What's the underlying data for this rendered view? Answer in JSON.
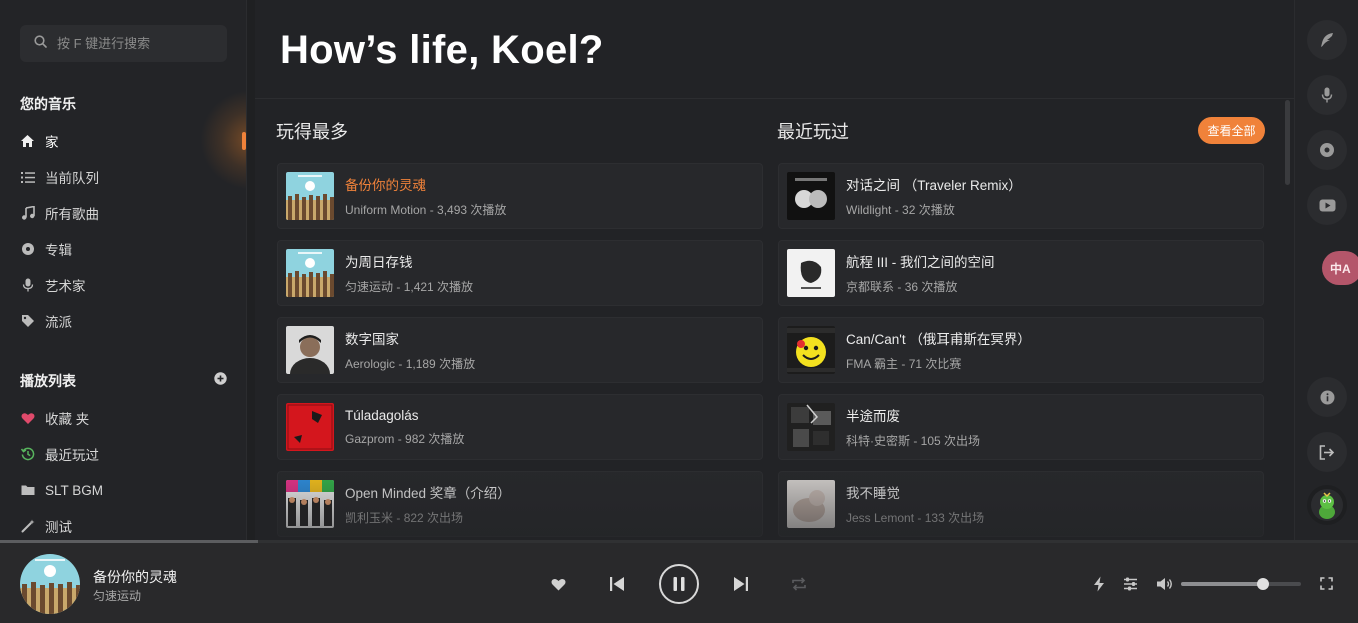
{
  "search": {
    "placeholder": "按 F 键进行搜索"
  },
  "sidebar": {
    "your_music_title": "您的音乐",
    "nav": [
      {
        "label": "家",
        "icon": "home-icon"
      },
      {
        "label": "当前队列",
        "icon": "queue-icon"
      },
      {
        "label": "所有歌曲",
        "icon": "music-note-icon"
      },
      {
        "label": "专辑",
        "icon": "album-icon"
      },
      {
        "label": "艺术家",
        "icon": "microphone-icon"
      },
      {
        "label": "流派",
        "icon": "tag-icon"
      }
    ],
    "playlists_title": "播放列表",
    "playlists": [
      {
        "label": "收藏 夹",
        "icon": "heart-icon",
        "color": "#e04a6b"
      },
      {
        "label": "最近玩过",
        "icon": "history-icon",
        "color": "#58b55e"
      },
      {
        "label": "SLT BGM",
        "icon": "folder-icon",
        "color": "#bdbdbd"
      },
      {
        "label": "测试",
        "icon": "magic-wand-icon",
        "color": "#bdbdbd"
      }
    ]
  },
  "main": {
    "greeting": "How’s life, Koel?",
    "most_played_title": "玩得最多",
    "recently_played_title": "最近玩过",
    "view_all_label": "查看全部",
    "most_played": [
      {
        "title": "备份你的灵魂",
        "artist": "Uniform Motion",
        "plays": "3,493 次播放",
        "cover": "cartoon-fence"
      },
      {
        "title": "为周日存钱",
        "artist": "匀速运动",
        "plays": "1,421 次播放",
        "cover": "cartoon-fence"
      },
      {
        "title": "数字国家",
        "artist": "Aerologic",
        "plays": "1,189 次播放",
        "cover": "portrait"
      },
      {
        "title": "Túladagolás",
        "artist": "Gazprom",
        "plays": "982 次播放",
        "cover": "red-square"
      },
      {
        "title": "Open Minded 奖章（介绍）",
        "artist": "凯利玉米",
        "plays": "822 次出场",
        "cover": "colorful"
      }
    ],
    "recently_played": [
      {
        "title": "对话之间 （Traveler Remix）",
        "artist": "Wildlight",
        "plays": "32 次播放",
        "cover": "dark-faces"
      },
      {
        "title": "航程 III - 我们之间的空间",
        "artist": "京都联系",
        "plays": "36 次播放",
        "cover": "white-sketch"
      },
      {
        "title": "Can/Can't （俄耳甫斯在冥界）",
        "artist": "FMA 霸主",
        "plays": "71 次比赛",
        "cover": "yellow-smiley"
      },
      {
        "title": "半途而废",
        "artist": "科特·史密斯",
        "plays": "105 次出场",
        "cover": "dark-collage"
      },
      {
        "title": "我不睡觉",
        "artist": "Jess Lemont",
        "plays": "133 次出场",
        "cover": "pale-photo"
      }
    ]
  },
  "rail": {
    "icons": [
      "feather-icon",
      "microphone-icon",
      "disc-icon",
      "youtube-icon",
      "info-icon",
      "logout-icon",
      "avatar"
    ],
    "translate_label": "中A"
  },
  "player": {
    "title": "备份你的灵魂",
    "artist": "匀速运动",
    "progress": 0.19,
    "volume": 0.68,
    "state": "playing"
  },
  "colors": {
    "accent": "#f0823a",
    "background": "#1f2022",
    "card": "#27282b"
  }
}
